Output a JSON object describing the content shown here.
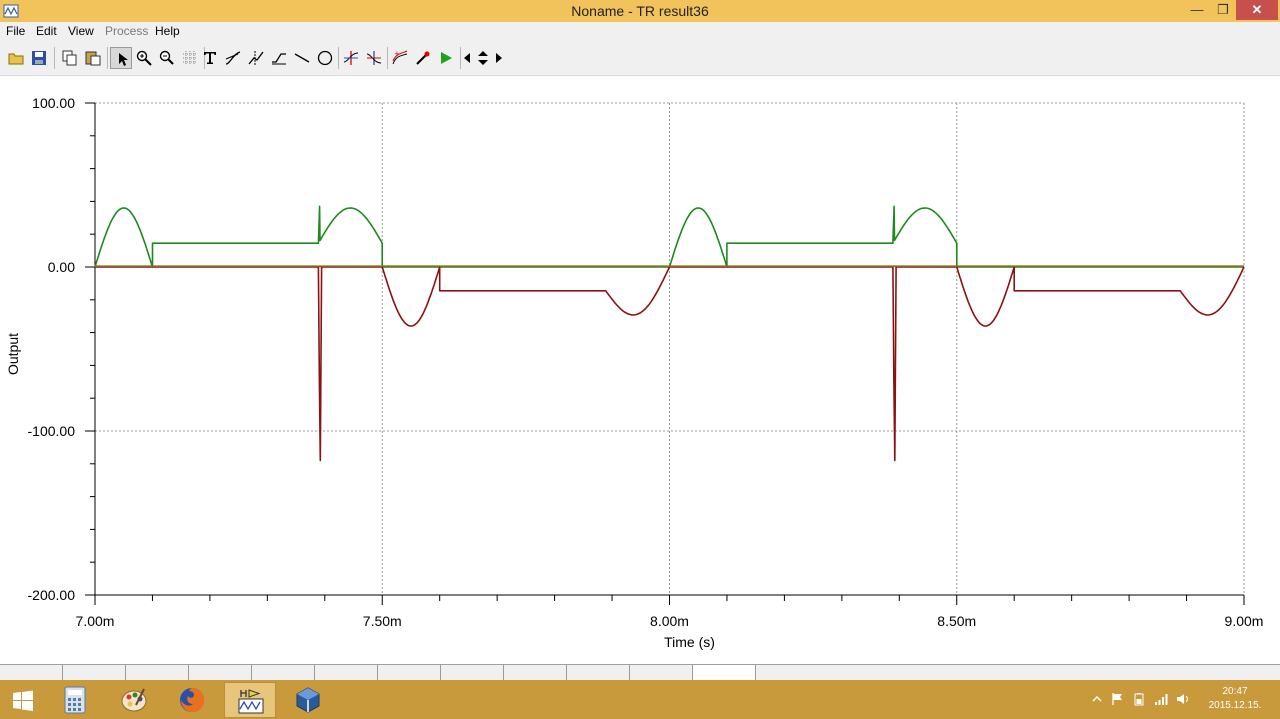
{
  "window": {
    "title": "Noname - TR result36",
    "controls": {
      "minimize": "—",
      "maximize": "❐",
      "close": "✕"
    }
  },
  "menu": {
    "items": [
      {
        "label": "File",
        "enabled": true
      },
      {
        "label": "Edit",
        "enabled": true
      },
      {
        "label": "View",
        "enabled": true
      },
      {
        "label": "Process",
        "enabled": false
      },
      {
        "label": "Help",
        "enabled": true
      }
    ]
  },
  "toolbar": {
    "buttons": [
      "open-folder-icon",
      "save-disk-icon",
      "copy-icon",
      "paste-icon",
      "pointer-icon",
      "zoom-in-icon",
      "zoom-100-icon",
      "grid-icon",
      "text-tool-icon",
      "tangent-icon",
      "cursor-line-icon",
      "ramp-icon",
      "line-tool-icon",
      "ellipse-tool-icon",
      "cursor-a-icon",
      "cursor-b-icon",
      "add-curve-icon",
      "probe-icon",
      "run-icon",
      "scroll-left-icon",
      "scroll-updown-icon",
      "scroll-right-icon"
    ],
    "pressed": "pointer-icon"
  },
  "chart_data": {
    "type": "line",
    "xlabel": "Time (s)",
    "ylabel": "Output",
    "xlim": [
      0.007,
      0.009
    ],
    "ylim": [
      -200,
      100
    ],
    "x_ticks": [
      {
        "value": 0.007,
        "label": "7.00m"
      },
      {
        "value": 0.0075,
        "label": "7.50m"
      },
      {
        "value": 0.008,
        "label": "8.00m"
      },
      {
        "value": 0.0085,
        "label": "8.50m"
      },
      {
        "value": 0.009,
        "label": "9.00m"
      }
    ],
    "y_ticks": [
      {
        "value": 100,
        "label": "100.00"
      },
      {
        "value": 0,
        "label": "0.00"
      },
      {
        "value": -100,
        "label": "-100.00"
      },
      {
        "value": -200,
        "label": "-200.00"
      }
    ],
    "grid": true,
    "period": 0.001,
    "series": [
      {
        "color": "#1e8a1e",
        "segments": [
          {
            "kind": "hump",
            "from": 0.007,
            "to": 0.0071,
            "base": 0,
            "peak": 36
          },
          {
            "kind": "flat",
            "from": 0.0071,
            "to": 0.0073889,
            "level": 14.5
          },
          {
            "kind": "hump",
            "from": 0.0073889,
            "to": 0.0075,
            "base": 14.5,
            "peak": 36,
            "start_spike": 37
          },
          {
            "kind": "flat",
            "from": 0.0075,
            "to": 0.008,
            "level": 0
          }
        ]
      },
      {
        "color": "#8b1212",
        "segments": [
          {
            "kind": "flat",
            "from": 0.007,
            "to": 0.0073889,
            "level": 0
          },
          {
            "kind": "spike",
            "at": 0.0073889,
            "to": 0.0074,
            "depth": -118
          },
          {
            "kind": "flat",
            "from": 0.0074,
            "to": 0.0075,
            "level": 0
          },
          {
            "kind": "hump",
            "from": 0.0075,
            "to": 0.0076,
            "base": 0,
            "peak": -36
          },
          {
            "kind": "flat",
            "from": 0.0076,
            "to": 0.0078889,
            "level": -14.5
          },
          {
            "kind": "hump",
            "from": 0.0078889,
            "to": 0.008,
            "base": -14.5,
            "peak": -36,
            "end": 0
          }
        ]
      },
      {
        "color": "#8a6a10",
        "segments": [
          {
            "kind": "flat",
            "from": 0.007,
            "to": 0.009,
            "level": 0.5
          }
        ]
      }
    ]
  },
  "tabs": {
    "count": 12,
    "selected": 11
  },
  "taskbar": {
    "apps": [
      "windows-start-icon",
      "calculator-icon",
      "paint-icon",
      "firefox-icon",
      "tina-simulator-icon",
      "virtualbox-icon"
    ],
    "active": "tina-simulator-icon",
    "tray_icons": [
      "show-hidden-icons-icon",
      "flag-icon",
      "power-icon",
      "network-icon",
      "volume-icon"
    ],
    "time": "20:47",
    "date": "2015.12.15."
  }
}
